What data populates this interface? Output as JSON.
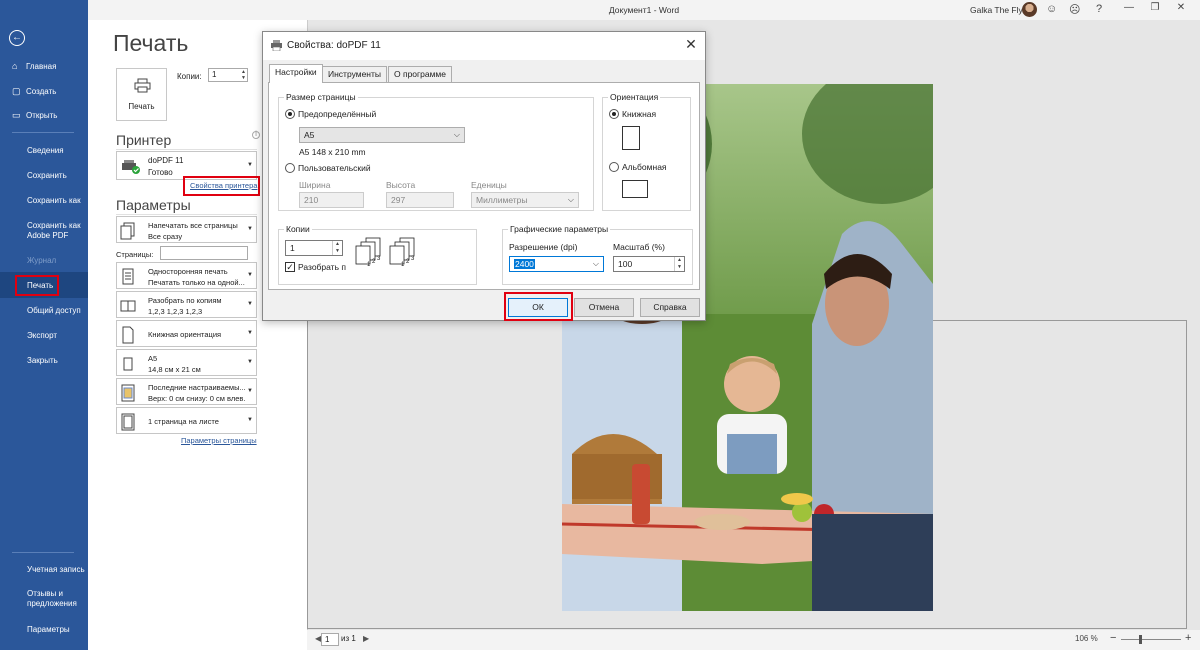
{
  "window": {
    "title": "Документ1 - Word",
    "user": "Galka The Fly"
  },
  "icons": {
    "emoji_happy": "☺",
    "emoji_sad": "☹",
    "help": "?",
    "minimize": "—",
    "restore": "❐",
    "close": "✕"
  },
  "sidebar": {
    "back": "←",
    "items": [
      {
        "label": "Главная",
        "icon": "⌂"
      },
      {
        "label": "Создать",
        "icon": "▢"
      },
      {
        "label": "Открыть",
        "icon": "▭"
      }
    ],
    "items2": [
      {
        "label": "Сведения"
      },
      {
        "label": "Сохранить"
      },
      {
        "label": "Сохранить как"
      },
      {
        "label": "Сохранить как Adobe PDF"
      },
      {
        "label": "Журнал"
      },
      {
        "label": "Печать"
      },
      {
        "label": "Общий доступ"
      },
      {
        "label": "Экспорт"
      },
      {
        "label": "Закрыть"
      }
    ],
    "bottom": [
      {
        "label": "Учетная запись"
      },
      {
        "label": "Отзывы и предложения"
      },
      {
        "label": "Параметры"
      }
    ]
  },
  "print": {
    "title": "Печать",
    "print_button": "Печать",
    "copies_label": "Копии:",
    "copies_value": "1",
    "printer_section": "Принтер",
    "printer_name": "doPDF 11",
    "printer_status": "Готово",
    "printer_props": "Свойства принтера",
    "params_section": "Параметры",
    "pages_label": "Страницы:",
    "pages_value": "",
    "page_setup": "Параметры страницы",
    "params": [
      {
        "l1": "Напечатать все страницы",
        "l2": "Все сразу"
      },
      {
        "l1": "Односторонняя печать",
        "l2": "Печатать только на одной..."
      },
      {
        "l1": "Разобрать по копиям",
        "l2": "1,2,3    1,2,3    1,2,3"
      },
      {
        "l1": "Книжная ориентация",
        "l2": ""
      },
      {
        "l1": "A5",
        "l2": "14,8 см x 21 см"
      },
      {
        "l1": "Последние настраиваемы...",
        "l2": "Верх: 0 см снизу: 0 см влев..."
      },
      {
        "l1": "1 страница на листе",
        "l2": ""
      }
    ]
  },
  "preview": {
    "page_current": "1",
    "page_of": "из 1",
    "zoom": "106 %",
    "nav_prev": "◀",
    "nav_next": "▶",
    "zoom_minus": "−",
    "zoom_plus": "+"
  },
  "dialog": {
    "title": "Свойства: doPDF 11",
    "tabs": [
      "Настройки",
      "Инструменты",
      "О программе"
    ],
    "page_size_group": "Размер страницы",
    "predefined": "Предопределённый",
    "size_value": "A5",
    "size_desc": "A5 148 x 210 mm",
    "custom": "Пользовательский",
    "width_label": "Ширина",
    "width_value": "210",
    "height_label": "Высота",
    "height_value": "297",
    "units_label": "Еденицы",
    "units_value": "Миллиметры",
    "orientation_group": "Ориентация",
    "portrait": "Книжная",
    "landscape": "Альбомная",
    "copies_group": "Копии",
    "copies_value": "1",
    "collate": "Разобрать п",
    "graphics_group": "Графические параметры",
    "resolution_label": "Разрешение (dpi)",
    "resolution_value": "2400",
    "scale_label": "Масштаб (%)",
    "scale_value": "100",
    "ok": "ОК",
    "cancel": "Отмена",
    "help": "Справка"
  }
}
